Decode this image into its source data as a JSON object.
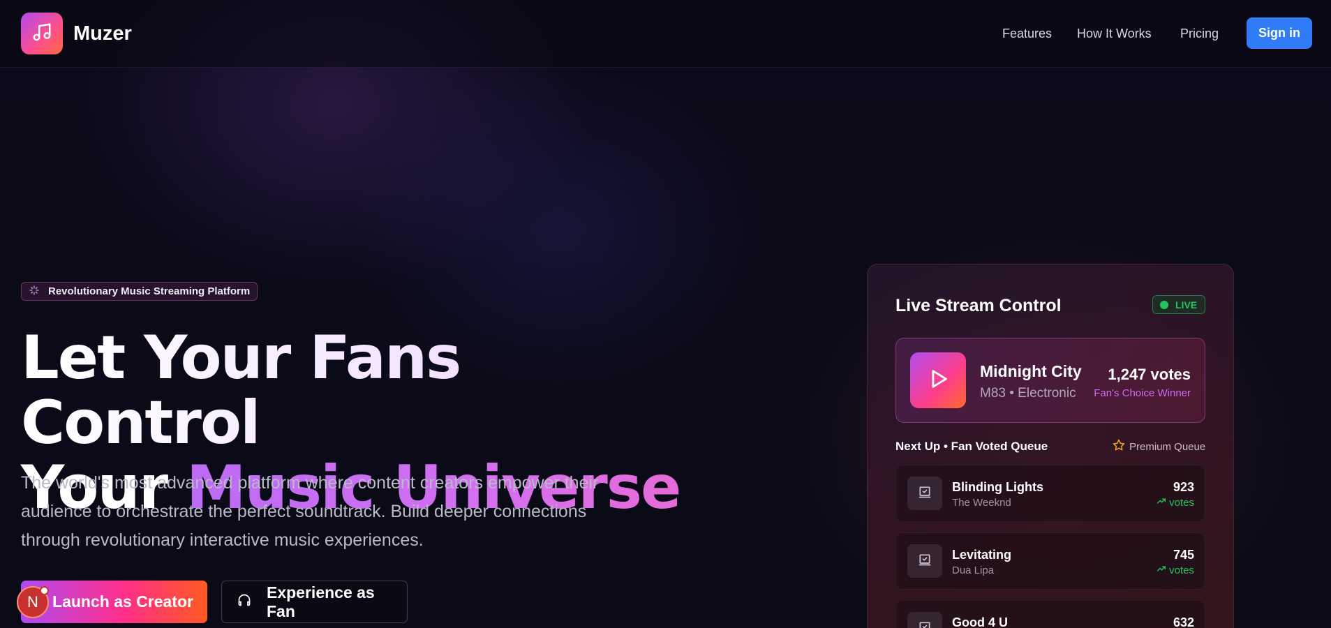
{
  "nav": {
    "brand": "Muzer",
    "links": [
      "Features",
      "How It Works",
      "Pricing"
    ],
    "signin": "Sign in"
  },
  "hero": {
    "badge": "Revolutionary Music Streaming Platform",
    "headline_line1": "Let Your Fans Control",
    "headline_line2_plain": "Your ",
    "headline_line2_accent": "Music Universe",
    "description": "The world's most advanced platform where content creators empower their audience to orchestrate the perfect soundtrack. Build deeper connections through revolutionary interactive music experiences.",
    "cta_creator": "Launch as Creator",
    "cta_fan": "Experience as Fan",
    "avatar_initial": "N"
  },
  "panel": {
    "title": "Live Stream Control",
    "live_label": "LIVE",
    "now_playing": {
      "title": "Midnight City",
      "artist": "M83 • Electronic",
      "votes": "1,247 votes",
      "badge": "Fan's Choice Winner"
    },
    "queue_heading": "Next Up • Fan Voted Queue",
    "premium_label": "Premium Queue",
    "queue": [
      {
        "title": "Blinding Lights",
        "artist": "The Weeknd",
        "count": "923",
        "votes_label": "votes"
      },
      {
        "title": "Levitating",
        "artist": "Dua Lipa",
        "count": "745",
        "votes_label": "votes"
      },
      {
        "title": "Good 4 U",
        "artist": "",
        "count": "632",
        "votes_label": ""
      }
    ]
  },
  "colors": {
    "accent_blue": "#2f7cf6",
    "accent_purple": "#bb6bf4",
    "live_green": "#22c55e",
    "premium_star": "#f5a623"
  },
  "icons": {
    "logo": "music-note-icon",
    "badge": "sparkles-icon",
    "fan_button": "headphones-icon",
    "now_playing": "play-icon",
    "queue_item": "check-square-icon",
    "trend": "trending-up-icon",
    "premium": "star-icon"
  }
}
